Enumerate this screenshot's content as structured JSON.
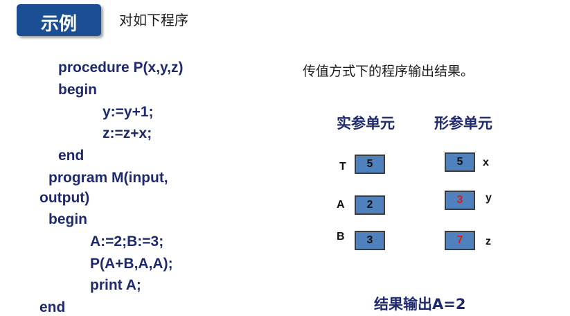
{
  "header": {
    "badge": "示例",
    "subtitle": "对如下程序"
  },
  "code": {
    "lines": [
      "procedure P(x,y,z)",
      "begin",
      "y:=y+1;",
      "z:=z+x;",
      "end",
      "program M(input,",
      "output)",
      "begin",
      "A:=2;B:=3;",
      "P(A+B,A,A);",
      "print A;",
      "end"
    ]
  },
  "description": "传值方式下的程序输出结果。",
  "table": {
    "actual_header": "实参单元",
    "formal_header": "形参单元",
    "actual_cells": [
      {
        "label": "T",
        "value": "5"
      },
      {
        "label": "A",
        "value": "2"
      },
      {
        "label": "B",
        "value": "3"
      }
    ],
    "formal_cells": [
      {
        "label": "x",
        "value": "5"
      },
      {
        "label": "y",
        "value": "3"
      },
      {
        "label": "z",
        "value": "7"
      }
    ]
  },
  "result": "结果输出A=2",
  "colors": {
    "badge": "#1b4f93",
    "code_text": "#1f2a6e",
    "cell_fill": "#4f81bd",
    "changed_value": "#d21e1e"
  }
}
